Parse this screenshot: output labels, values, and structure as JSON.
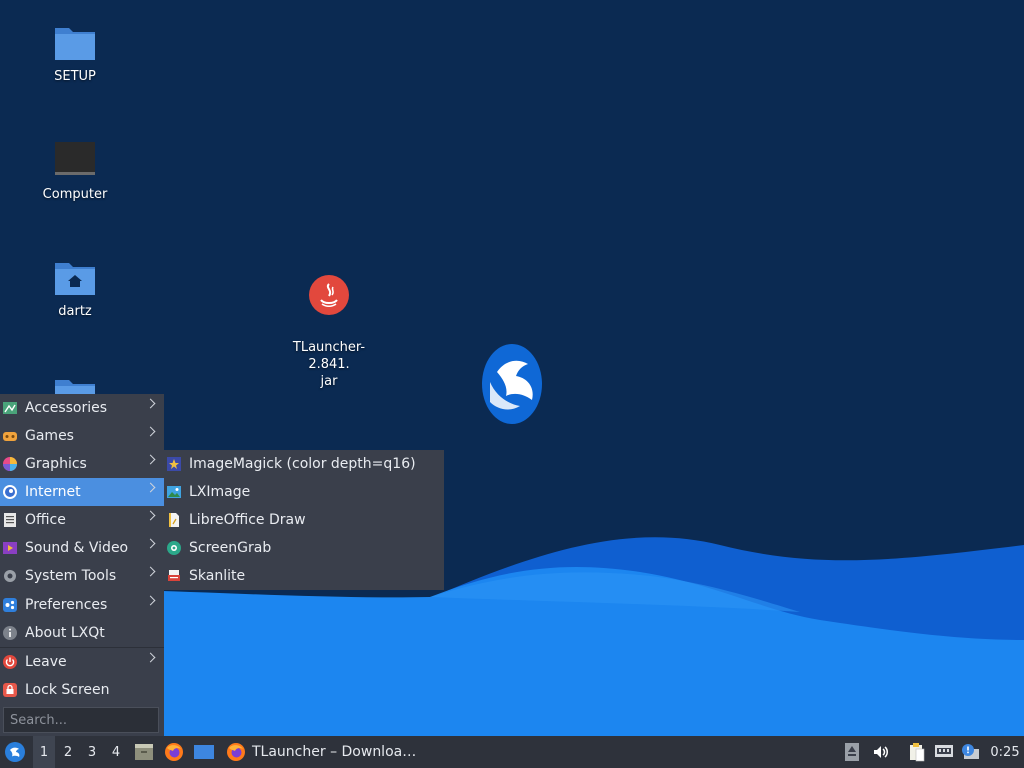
{
  "desktop": {
    "icons": [
      {
        "label": "SETUP",
        "icon": "folder-icon"
      },
      {
        "label": "Computer",
        "icon": "computer-icon"
      },
      {
        "label": "dartz",
        "icon": "home-folder-icon"
      },
      {
        "label": "TLauncher-2.841.\njar",
        "icon": "java-icon"
      }
    ],
    "colors": {
      "background": "#0b2a52",
      "wave_light": "#1c86f0",
      "wave_dark": "#0f5fd0",
      "menu_bg": "#3a3f4b",
      "highlight": "#4b8fe0",
      "taskbar": "#2e323b"
    }
  },
  "start_menu": {
    "items": [
      {
        "label": "Accessories",
        "icon": "accessories-icon",
        "has_submenu": true
      },
      {
        "label": "Games",
        "icon": "games-icon",
        "has_submenu": true
      },
      {
        "label": "Graphics",
        "icon": "graphics-icon",
        "has_submenu": true
      },
      {
        "label": "Internet",
        "icon": "internet-icon",
        "has_submenu": true,
        "active": true
      },
      {
        "label": "Office",
        "icon": "office-icon",
        "has_submenu": true
      },
      {
        "label": "Sound & Video",
        "icon": "sound-video-icon",
        "has_submenu": true
      },
      {
        "label": "System Tools",
        "icon": "system-tools-icon",
        "has_submenu": true
      },
      {
        "label": "Preferences",
        "icon": "preferences-icon",
        "has_submenu": true
      },
      {
        "label": "About LXQt",
        "icon": "info-icon",
        "has_submenu": false
      },
      {
        "label": "Leave",
        "icon": "power-icon",
        "has_submenu": true
      },
      {
        "label": "Lock Screen",
        "icon": "lock-icon",
        "has_submenu": false
      }
    ],
    "search_placeholder": "Search..."
  },
  "submenu": {
    "items": [
      {
        "label": "ImageMagick (color depth=q16)",
        "icon": "imagemagick-icon"
      },
      {
        "label": "LXImage",
        "icon": "image-viewer-icon"
      },
      {
        "label": "LibreOffice Draw",
        "icon": "libreoffice-draw-icon"
      },
      {
        "label": "ScreenGrab",
        "icon": "screengrab-icon"
      },
      {
        "label": "Skanlite",
        "icon": "scanner-icon"
      }
    ]
  },
  "taskbar": {
    "workspaces": [
      "1",
      "2",
      "3",
      "4"
    ],
    "active_workspace": "1",
    "task_title": "TLauncher – Downloa…",
    "clock": "0:25"
  }
}
